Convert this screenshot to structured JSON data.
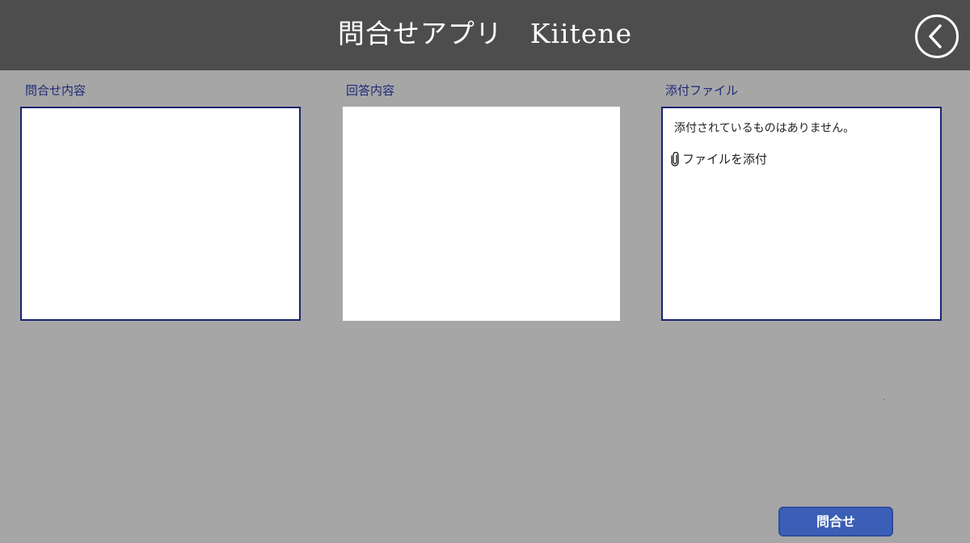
{
  "header": {
    "title": "問合せアプリ　Kiitene",
    "back_icon": "chevron-left-circle-icon",
    "background": "#4d4d4d"
  },
  "inquiry": {
    "label": "問合せ内容",
    "value": ""
  },
  "answer": {
    "label": "回答内容",
    "value": ""
  },
  "attachments": {
    "label": "添付ファイル",
    "empty_text": "添付されているものはありません。",
    "add_label": "ファイルを添付",
    "add_icon": "paperclip-icon"
  },
  "footer": {
    "submit_label": "問合せ",
    "submit_color": "#3b5eb6"
  },
  "colors": {
    "background": "#a6a6a6",
    "label": "#1f2a78",
    "box_border": "#1a2470"
  }
}
